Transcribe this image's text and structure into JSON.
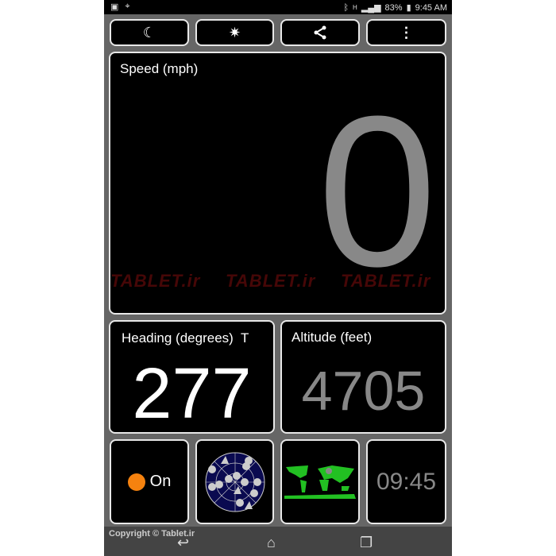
{
  "status_bar": {
    "battery": "83%",
    "time": "9:45 AM",
    "network": "H"
  },
  "toolbar": {
    "buttons": [
      {
        "icon": "night-mode-icon"
      },
      {
        "icon": "brightness-icon"
      },
      {
        "icon": "share-icon"
      },
      {
        "icon": "overflow-menu-icon"
      }
    ]
  },
  "speed": {
    "label": "Speed (mph)",
    "value": "0"
  },
  "heading": {
    "label": "Heading (degrees)",
    "ref": "T",
    "value": "277"
  },
  "altitude": {
    "label": "Altitude (feet)",
    "value": "4705"
  },
  "tiles": {
    "gps_status": "On",
    "gps_color": "#f5820f",
    "clock": "09:45"
  },
  "watermark": "TABLET.ir",
  "footer": {
    "copyright": "Copyright © Tablet.ir"
  }
}
